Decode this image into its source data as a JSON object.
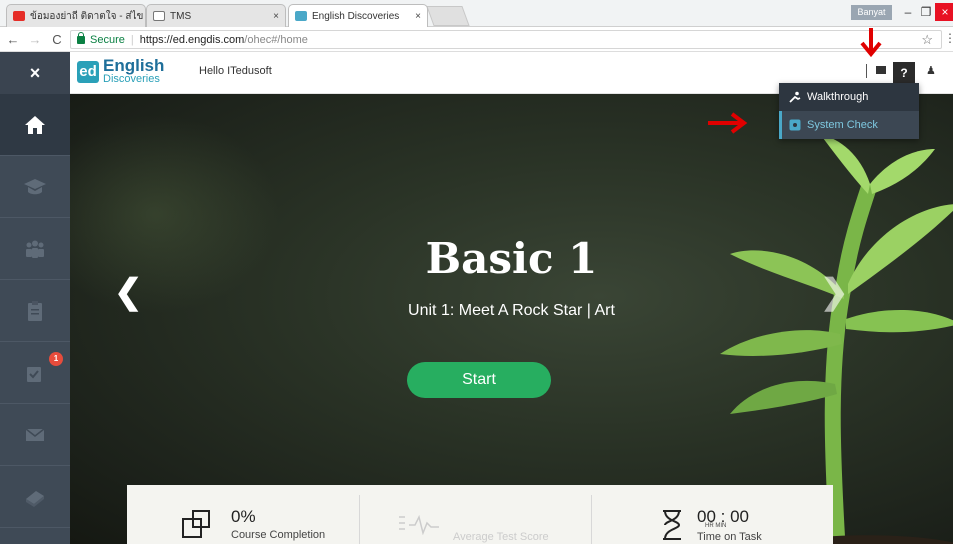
{
  "browser": {
    "tabs": [
      {
        "title": "ข้อมองย่าถี ติดาตใจ - ส่ไข",
        "mute_icon": "speaker-icon"
      },
      {
        "title": "TMS"
      },
      {
        "title": "English Discoveries"
      }
    ],
    "user_chip": "Banyat",
    "address": {
      "secure_label": "Secure",
      "separator": "|",
      "host": "https://ed.engdis.com",
      "path": "/ohec#/home"
    }
  },
  "app": {
    "logo": {
      "badge": "ed",
      "line1": "English",
      "line2": "Discoveries"
    },
    "greeting": "Hello ITedusoft",
    "help_label": "?",
    "sidebar": {
      "close_label": "×",
      "items": [
        {
          "icon": "home-icon",
          "active": true
        },
        {
          "icon": "graduation-cap-icon"
        },
        {
          "icon": "community-icon"
        },
        {
          "icon": "clipboard-icon"
        },
        {
          "icon": "assignments-icon",
          "badge": "1"
        },
        {
          "icon": "envelope-icon"
        },
        {
          "icon": "book-icon"
        }
      ]
    },
    "help_menu": {
      "items": [
        {
          "label": "Walkthrough",
          "icon": "walkthrough-icon"
        },
        {
          "label": "System Check",
          "icon": "gear-icon",
          "highlighted": true
        }
      ]
    }
  },
  "hero": {
    "title": "Basic 1",
    "subtitle": "Unit 1: Meet A Rock Star  |  Art",
    "start_label": "Start"
  },
  "stats": {
    "completion": {
      "value": "0%",
      "label": "Course Completion"
    },
    "test_score": {
      "label": "Average Test Score"
    },
    "time_on_task": {
      "value": "00 : 00",
      "units": "HR   MIN",
      "label": "Time on Task"
    }
  },
  "colors": {
    "sidebar": "#3f4a56",
    "start_button": "#27ae60",
    "brand": "#2aa0b8",
    "annotation": "#e00000"
  }
}
